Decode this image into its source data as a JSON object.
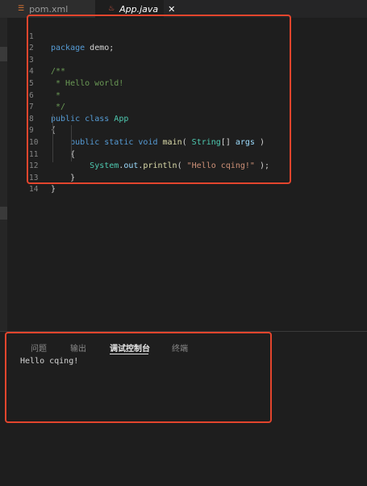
{
  "tabs": [
    {
      "label": "pom.xml",
      "icon": "rss-icon"
    },
    {
      "label": "App.java",
      "icon": "java-icon",
      "close": "✕"
    }
  ],
  "editor": {
    "line_numbers": [
      "1",
      "2",
      "3",
      "4",
      "5",
      "6",
      "7",
      "8",
      "9",
      "10",
      "11",
      "12",
      "13",
      "14"
    ],
    "lines": [
      "package demo;",
      "",
      "/**",
      " * Hello world!",
      " *",
      " */",
      "public class App",
      "{",
      "    public static void main( String[] args )",
      "    {",
      "        System.out.println( \"Hello cqing!\" );",
      "    }",
      "}",
      ""
    ]
  },
  "panel": {
    "tabs": [
      "问题",
      "输出",
      "调试控制台",
      "终端"
    ],
    "active_tab": "调试控制台",
    "output": "Hello cqing!"
  },
  "colors": {
    "highlight": "#e3452d",
    "keyword": "#569cd6",
    "comment": "#6a9955",
    "type": "#4ec9b0",
    "function": "#dcdcaa",
    "string": "#ce9178"
  }
}
